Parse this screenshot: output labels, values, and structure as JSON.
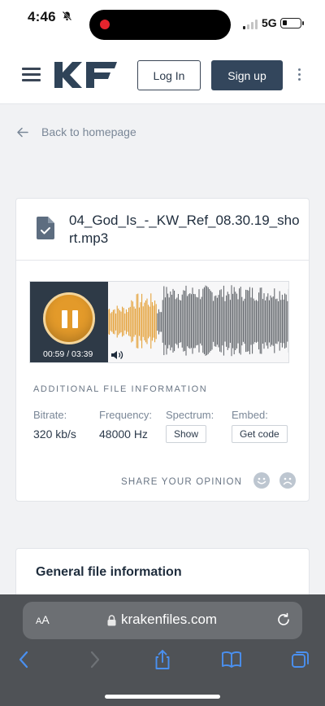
{
  "status_bar": {
    "time": "4:46",
    "network": "5G"
  },
  "header": {
    "logo_text": "KF",
    "login_label": "Log In",
    "signup_label": "Sign up"
  },
  "back_link": {
    "label": "Back to homepage"
  },
  "file_card": {
    "file_name": "04_God_Is_-_KW_Ref_08.30.19_short.mp3",
    "player": {
      "current_time": "00:59",
      "duration": "03:39",
      "progress": 0.27
    },
    "section_title": "ADDITIONAL FILE INFORMATION",
    "info": [
      {
        "label": "Bitrate:",
        "value": "320 kb/s"
      },
      {
        "label": "Frequency:",
        "value": "48000 Hz"
      },
      {
        "label": "Spectrum:",
        "button": "Show"
      },
      {
        "label": "Embed:",
        "button": "Get code"
      }
    ],
    "share_label": "SHARE YOUR OPINION"
  },
  "general_card": {
    "title": "General file information"
  },
  "browser": {
    "text_size_label": "AA",
    "url": "krakenfiles.com"
  },
  "colors": {
    "accent": "#e39a2a",
    "brand_dark": "#33465c",
    "player_dark": "#2e3a47"
  }
}
